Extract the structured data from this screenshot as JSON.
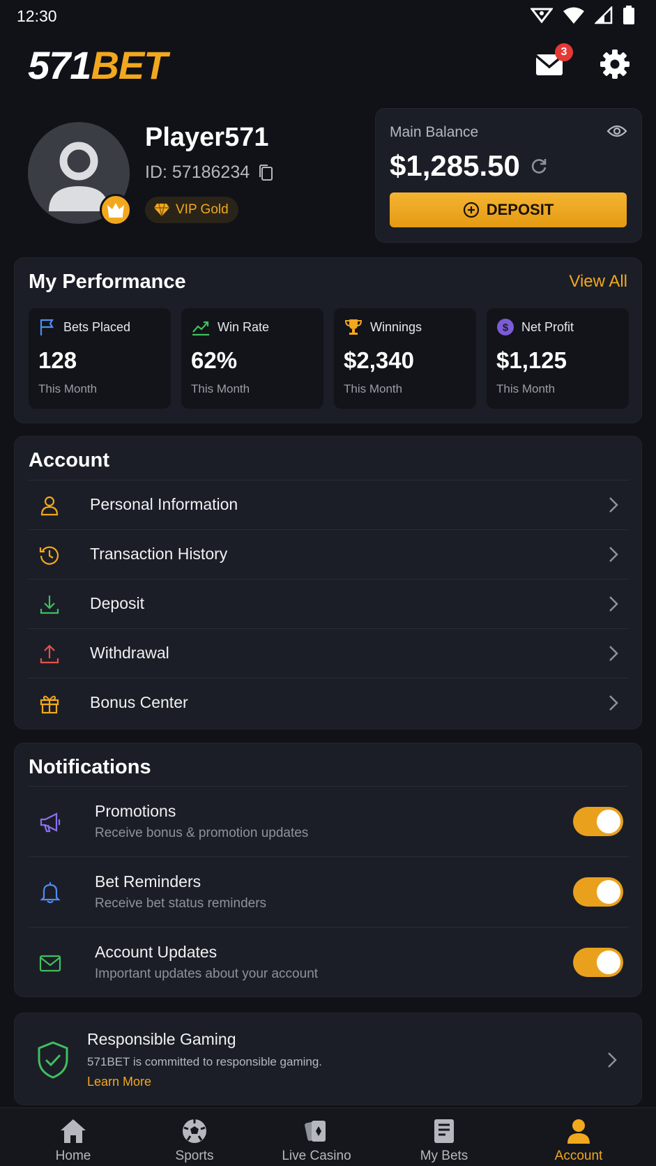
{
  "status_bar": {
    "time": "12:30"
  },
  "header": {
    "logo_white": "571",
    "logo_orange": "BET",
    "mail_badge": "3"
  },
  "profile": {
    "name": "Player571",
    "id_text": "ID: 57186234",
    "vip_label": "VIP Gold"
  },
  "balance": {
    "label": "Main Balance",
    "amount": "$1,285.50",
    "deposit_label": "DEPOSIT"
  },
  "performance": {
    "title": "My Performance",
    "view_all": "View All",
    "stats": [
      {
        "label": "Bets Placed",
        "value": "128",
        "sub": "This Month",
        "icon": "flag-icon"
      },
      {
        "label": "Win Rate",
        "value": "62%",
        "sub": "This Month",
        "icon": "trend-up-icon"
      },
      {
        "label": "Winnings",
        "value": "$2,340",
        "sub": "This Month",
        "icon": "trophy-icon"
      },
      {
        "label": "Net Profit",
        "value": "$1,125",
        "sub": "This Month",
        "icon": "dollar-coin-icon"
      }
    ]
  },
  "account": {
    "title": "Account",
    "items": [
      {
        "label": "Personal Information",
        "icon": "user-icon"
      },
      {
        "label": "Transaction History",
        "icon": "history-icon"
      },
      {
        "label": "Deposit",
        "icon": "download-icon"
      },
      {
        "label": "Withdrawal",
        "icon": "upload-icon"
      },
      {
        "label": "Bonus Center",
        "icon": "gift-icon"
      }
    ]
  },
  "notifications": {
    "title": "Notifications",
    "items": [
      {
        "title": "Promotions",
        "desc": "Receive bonus & promotion updates",
        "enabled": true,
        "icon": "megaphone-icon"
      },
      {
        "title": "Bet Reminders",
        "desc": "Receive bet status reminders",
        "enabled": true,
        "icon": "bell-icon"
      },
      {
        "title": "Account Updates",
        "desc": "Important updates about your account",
        "enabled": true,
        "icon": "envelope-icon"
      }
    ]
  },
  "responsible_gaming": {
    "title": "Responsible Gaming",
    "desc": "571BET is committed to responsible gaming.",
    "link": "Learn More"
  },
  "bottom_nav": {
    "items": [
      {
        "label": "Home",
        "icon": "home-icon"
      },
      {
        "label": "Sports",
        "icon": "soccer-ball-icon"
      },
      {
        "label": "Live Casino",
        "icon": "cards-icon"
      },
      {
        "label": "My Bets",
        "icon": "betslip-icon"
      },
      {
        "label": "Account",
        "icon": "account-icon",
        "active": true
      }
    ]
  },
  "colors": {
    "accent": "#f2a81e",
    "background": "#101217",
    "panel": "#1b1e26",
    "badge": "#e53935"
  }
}
